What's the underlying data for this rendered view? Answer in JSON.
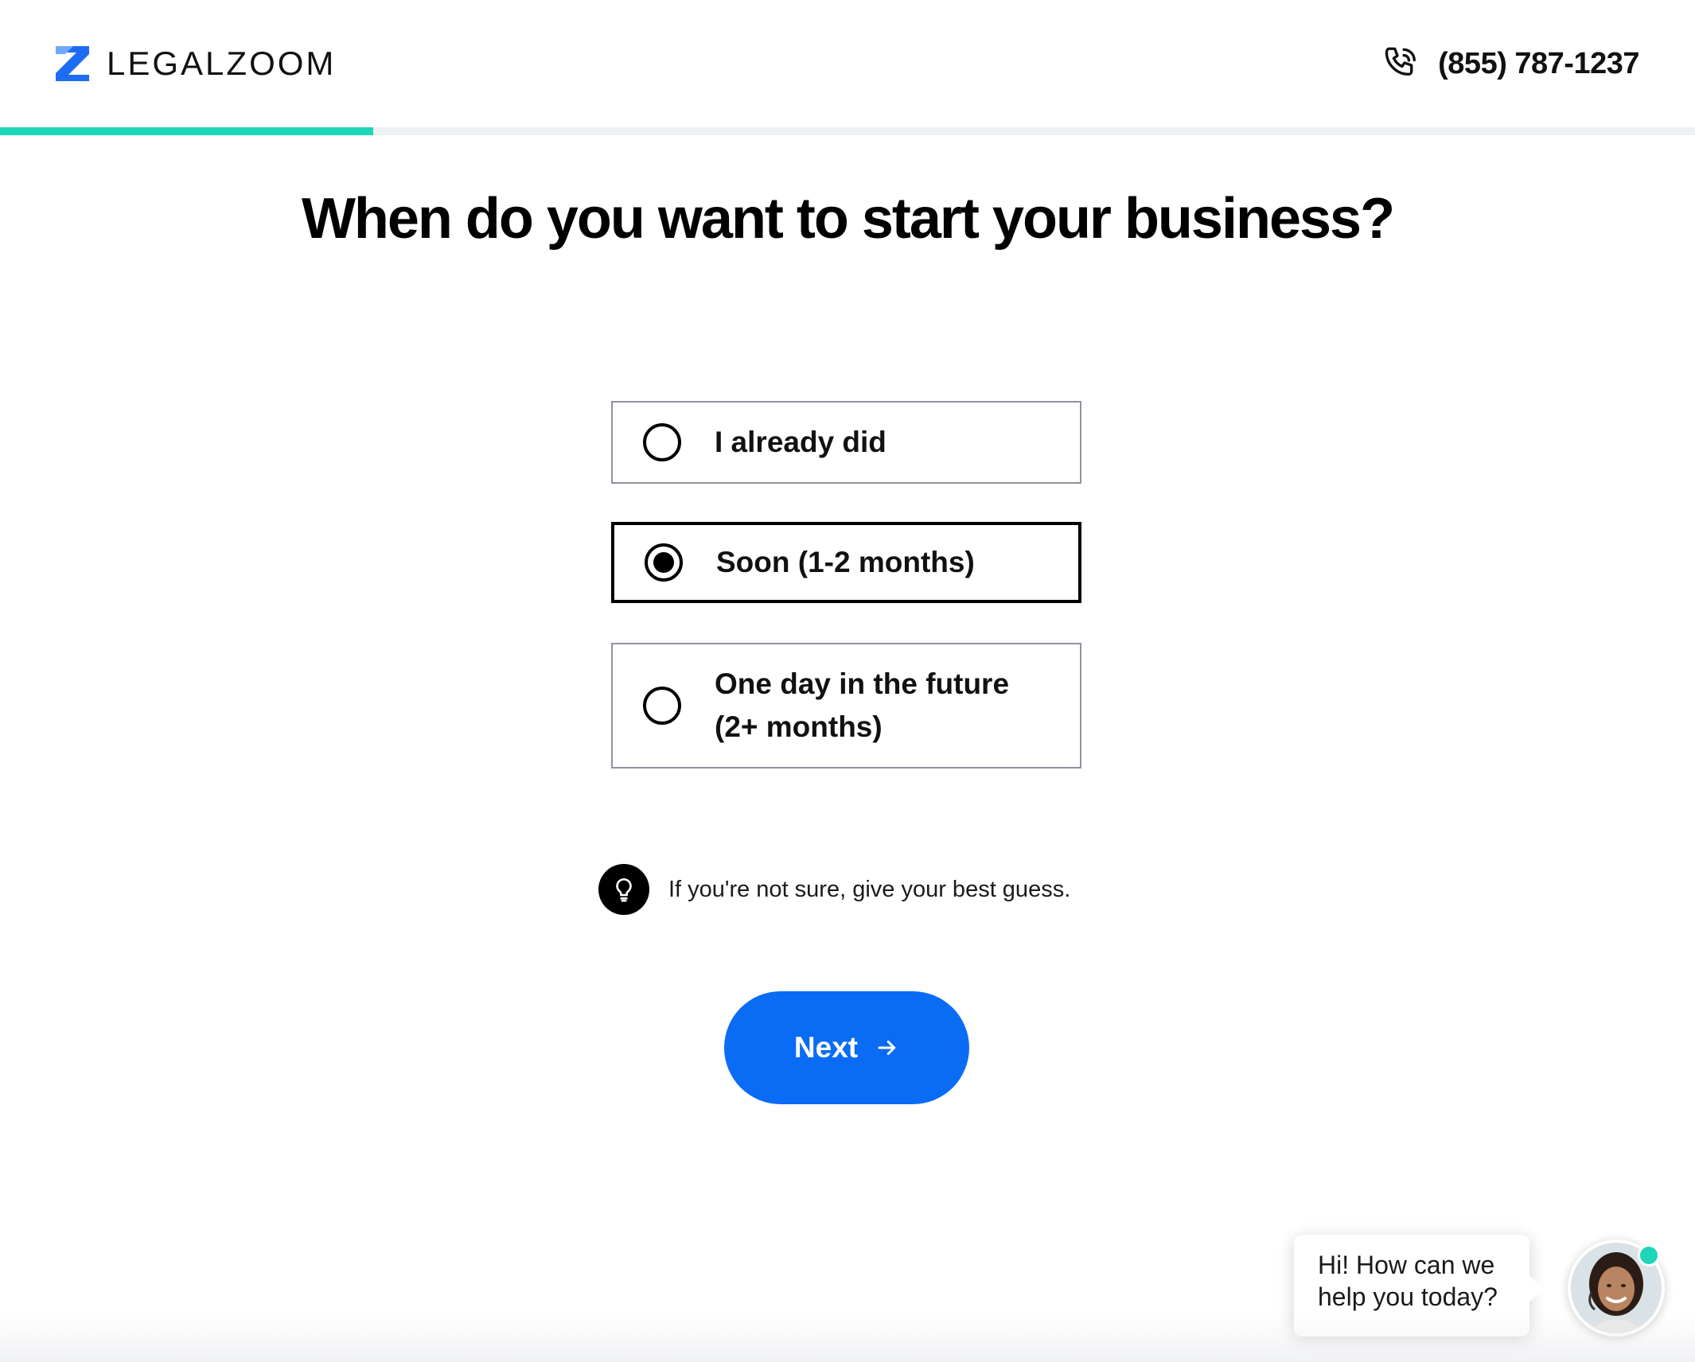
{
  "header": {
    "brand_name": "LEGALZOOM",
    "logo_icon": "legalzoom-z-logo",
    "phone_icon": "phone-icon",
    "phone_number": "(855) 787-1237"
  },
  "progress": {
    "percent": 22
  },
  "question": {
    "title": "When do you want to start your business?"
  },
  "options": [
    {
      "label": "I already did",
      "selected": false
    },
    {
      "label": "Soon (1-2 months)",
      "selected": true
    },
    {
      "label_line1": "One day in the future",
      "label_line2": "(2+ months)",
      "selected": false
    }
  ],
  "tip": {
    "icon": "lightbulb-icon",
    "text": "If you're not sure, give your best guess."
  },
  "next_button": {
    "label": "Next",
    "icon": "arrow-right-icon"
  },
  "chat": {
    "line1": "Hi! How can we",
    "line2": "help you today?",
    "avatar": "support-agent-avatar"
  },
  "colors": {
    "accent_teal": "#1ed6b8",
    "primary_blue": "#0a6cf5",
    "logo_blue": "#1d6cf2"
  }
}
